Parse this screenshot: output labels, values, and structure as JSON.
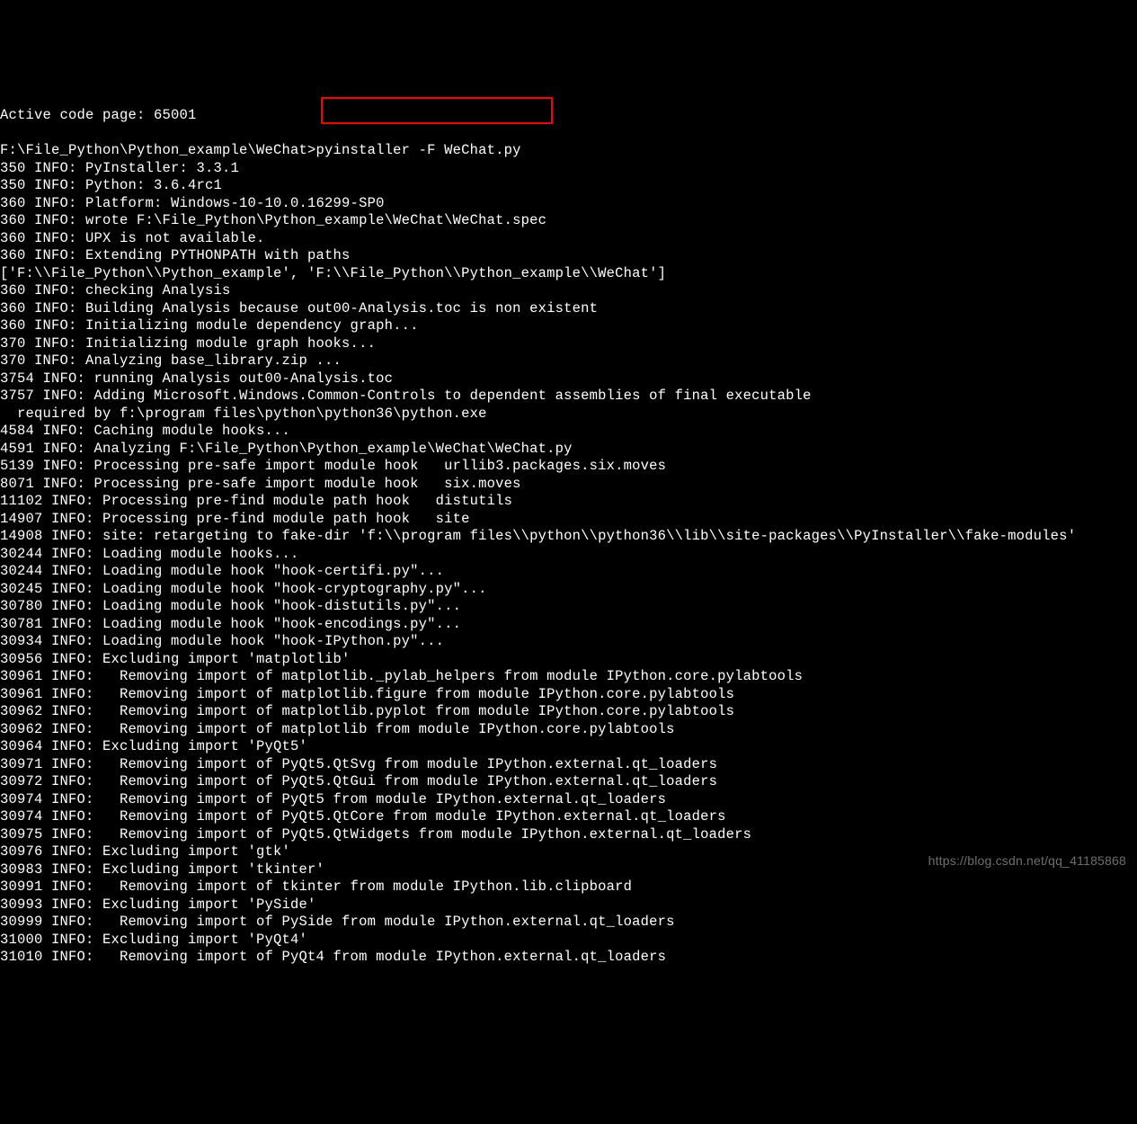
{
  "highlight": {
    "text": "pyinstaller -F WeChat.py"
  },
  "watermark": "https://blog.csdn.net/qq_41185868",
  "lines": [
    "Active code page: 65001",
    "",
    "F:\\File_Python\\Python_example\\WeChat>pyinstaller -F WeChat.py",
    "350 INFO: PyInstaller: 3.3.1",
    "350 INFO: Python: 3.6.4rc1",
    "360 INFO: Platform: Windows-10-10.0.16299-SP0",
    "360 INFO: wrote F:\\File_Python\\Python_example\\WeChat\\WeChat.spec",
    "360 INFO: UPX is not available.",
    "360 INFO: Extending PYTHONPATH with paths",
    "['F:\\\\File_Python\\\\Python_example', 'F:\\\\File_Python\\\\Python_example\\\\WeChat']",
    "360 INFO: checking Analysis",
    "360 INFO: Building Analysis because out00-Analysis.toc is non existent",
    "360 INFO: Initializing module dependency graph...",
    "370 INFO: Initializing module graph hooks...",
    "370 INFO: Analyzing base_library.zip ...",
    "3754 INFO: running Analysis out00-Analysis.toc",
    "3757 INFO: Adding Microsoft.Windows.Common-Controls to dependent assemblies of final executable",
    "  required by f:\\program files\\python\\python36\\python.exe",
    "4584 INFO: Caching module hooks...",
    "4591 INFO: Analyzing F:\\File_Python\\Python_example\\WeChat\\WeChat.py",
    "5139 INFO: Processing pre-safe import module hook   urllib3.packages.six.moves",
    "8071 INFO: Processing pre-safe import module hook   six.moves",
    "11102 INFO: Processing pre-find module path hook   distutils",
    "14907 INFO: Processing pre-find module path hook   site",
    "14908 INFO: site: retargeting to fake-dir 'f:\\\\program files\\\\python\\\\python36\\\\lib\\\\site-packages\\\\PyInstaller\\\\fake-modules'",
    "30244 INFO: Loading module hooks...",
    "30244 INFO: Loading module hook \"hook-certifi.py\"...",
    "30245 INFO: Loading module hook \"hook-cryptography.py\"...",
    "30780 INFO: Loading module hook \"hook-distutils.py\"...",
    "30781 INFO: Loading module hook \"hook-encodings.py\"...",
    "30934 INFO: Loading module hook \"hook-IPython.py\"...",
    "30956 INFO: Excluding import 'matplotlib'",
    "30961 INFO:   Removing import of matplotlib._pylab_helpers from module IPython.core.pylabtools",
    "30961 INFO:   Removing import of matplotlib.figure from module IPython.core.pylabtools",
    "30962 INFO:   Removing import of matplotlib.pyplot from module IPython.core.pylabtools",
    "30962 INFO:   Removing import of matplotlib from module IPython.core.pylabtools",
    "30964 INFO: Excluding import 'PyQt5'",
    "30971 INFO:   Removing import of PyQt5.QtSvg from module IPython.external.qt_loaders",
    "30972 INFO:   Removing import of PyQt5.QtGui from module IPython.external.qt_loaders",
    "30974 INFO:   Removing import of PyQt5 from module IPython.external.qt_loaders",
    "30974 INFO:   Removing import of PyQt5.QtCore from module IPython.external.qt_loaders",
    "30975 INFO:   Removing import of PyQt5.QtWidgets from module IPython.external.qt_loaders",
    "30976 INFO: Excluding import 'gtk'",
    "30983 INFO: Excluding import 'tkinter'",
    "30991 INFO:   Removing import of tkinter from module IPython.lib.clipboard",
    "30993 INFO: Excluding import 'PySide'",
    "30999 INFO:   Removing import of PySide from module IPython.external.qt_loaders",
    "31000 INFO: Excluding import 'PyQt4'",
    "31010 INFO:   Removing import of PyQt4 from module IPython.external.qt_loaders"
  ]
}
